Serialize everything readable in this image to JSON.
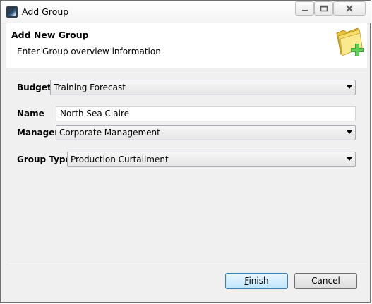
{
  "window": {
    "title": "Add Group"
  },
  "header": {
    "title": "Add New Group",
    "description": "Enter Group overview information",
    "icon": "folder-add-icon"
  },
  "form": {
    "budget": {
      "label": "Budget",
      "value": "Training Forecast"
    },
    "name": {
      "label": "Name",
      "value": "North Sea Claire"
    },
    "manager": {
      "label": "Manager",
      "value": "Corporate Management"
    },
    "group_type": {
      "label": "Group Type",
      "value": "Production Curtailment"
    }
  },
  "buttons": {
    "finish_first": "F",
    "finish_rest": "inish",
    "cancel": "Cancel"
  },
  "colors": {
    "accent": "#3c7fb1",
    "folder": "#f2d04b",
    "plus": "#3aa835"
  }
}
